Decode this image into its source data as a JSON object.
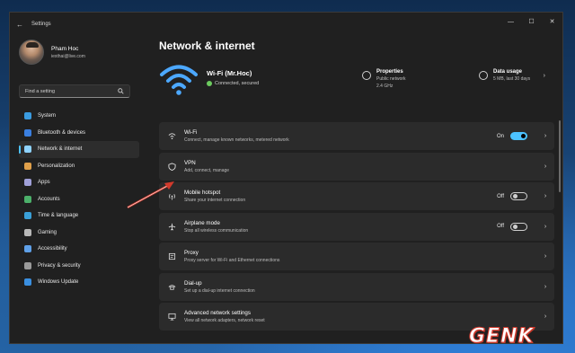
{
  "window": {
    "title": "Settings",
    "back_glyph": "←",
    "controls": {
      "minimize": "—",
      "maximize": "☐",
      "close": "✕"
    }
  },
  "profile": {
    "name": "Pham Hoc",
    "email": "iexthai@live.com"
  },
  "search": {
    "placeholder": "Find a setting"
  },
  "nav": [
    {
      "label": "System",
      "icon": "monitor-icon",
      "color": "#3a9be0"
    },
    {
      "label": "Bluetooth & devices",
      "icon": "bluetooth-icon",
      "color": "#3a7fe0"
    },
    {
      "label": "Network & internet",
      "icon": "network-icon",
      "color": "#8fd3ff",
      "active": true
    },
    {
      "label": "Personalization",
      "icon": "brush-icon",
      "color": "#e0a04a"
    },
    {
      "label": "Apps",
      "icon": "apps-icon",
      "color": "#a0a0d8"
    },
    {
      "label": "Accounts",
      "icon": "person-icon",
      "color": "#4cb06a"
    },
    {
      "label": "Time & language",
      "icon": "globe-clock-icon",
      "color": "#3aa0d8"
    },
    {
      "label": "Gaming",
      "icon": "controller-icon",
      "color": "#b8b8b8"
    },
    {
      "label": "Accessibility",
      "icon": "accessibility-icon",
      "color": "#5fa0e8"
    },
    {
      "label": "Privacy & security",
      "icon": "shield-icon",
      "color": "#9a9a9a"
    },
    {
      "label": "Windows Update",
      "icon": "update-icon",
      "color": "#3a8fe0"
    }
  ],
  "main": {
    "title": "Network & internet",
    "connection": {
      "name": "Wi-Fi (Mr.Hoc)",
      "status": "Connected, secured"
    },
    "properties": {
      "label": "Properties",
      "line1": "Public network",
      "line2": "2.4 GHz"
    },
    "data_usage": {
      "label": "Data usage",
      "line1": "5 MB, last 30 days"
    },
    "rows": [
      {
        "title": "Wi-Fi",
        "subtitle": "Connect, manage known networks, metered network",
        "icon": "wifi-icon",
        "state": "On",
        "toggle": "on"
      },
      {
        "title": "VPN",
        "subtitle": "Add, connect, manage",
        "icon": "vpn-shield-icon"
      },
      {
        "title": "Mobile hotspot",
        "subtitle": "Share your internet connection",
        "icon": "hotspot-icon",
        "state": "Off",
        "toggle": "off"
      },
      {
        "title": "Airplane mode",
        "subtitle": "Stop all wireless communication",
        "icon": "airplane-icon",
        "state": "Off",
        "toggle": "off"
      },
      {
        "title": "Proxy",
        "subtitle": "Proxy server for Wi-Fi and Ethernet connections",
        "icon": "proxy-icon"
      },
      {
        "title": "Dial-up",
        "subtitle": "Set up a dial-up internet connection",
        "icon": "dialup-icon"
      },
      {
        "title": "Advanced network settings",
        "subtitle": "View all network adapters, network reset",
        "icon": "monitor-network-icon"
      }
    ]
  },
  "watermark": "GENK",
  "colors": {
    "accent": "#4cc2ff",
    "window_bg": "#202020",
    "card_bg": "#2b2b2b",
    "arrow": "#d23a2c"
  }
}
